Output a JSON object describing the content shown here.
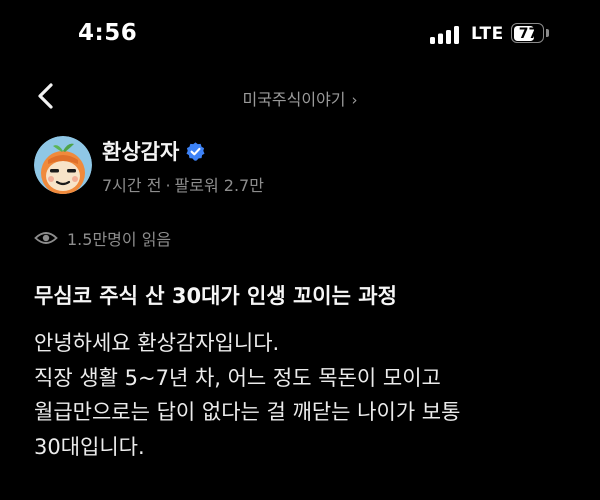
{
  "status_bar": {
    "time": "4:56",
    "network": "LTE",
    "battery_level": 77,
    "battery_label": "77",
    "signal_bars_filled": 4,
    "signal_bars_total": 4
  },
  "nav": {
    "back_icon": "chevron-left-icon",
    "community_label": "미국주식이야기",
    "community_chevron": "›"
  },
  "author": {
    "name": "환상감자",
    "verified_icon": "verified-badge-icon",
    "verified_color": "#3d82f6",
    "time_ago": "7시간 전",
    "separator": "·",
    "followers": "팔로워 2.7만"
  },
  "views": {
    "icon": "eye-icon",
    "label": "1.5만명이 읽음"
  },
  "post": {
    "title": "무심코 주식 산 30대가 인생 꼬이는 과정",
    "body_lines": [
      "안녕하세요 환상감자입니다.",
      "직장 생활 5~7년 차, 어느 정도 목돈이 모이고",
      "월급만으로는 답이 없다는 걸 깨닫는 나이가 보통",
      "30대입니다."
    ]
  }
}
